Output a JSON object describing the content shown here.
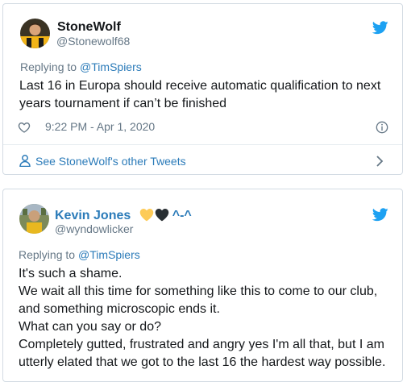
{
  "tweets": [
    {
      "display_name": "StoneWolf",
      "handle": "@Stonewolf68",
      "reply_prefix": "Replying to",
      "reply_to": "@TimSpiers",
      "body_lines": [
        "Last 16 in Europa should receive automatic qualification to next",
        "years tournament if can’t be finished"
      ],
      "timestamp": "9:22 PM - Apr 1, 2020",
      "see_other_tweets": "See StoneWolf's other Tweets",
      "icons": [
        "avatar",
        "twitter-logo-icon",
        "heart-icon",
        "info-icon",
        "person-icon",
        "chevron-right-icon"
      ]
    },
    {
      "display_name": "Kevin Jones",
      "name_suffix": "^-^",
      "handle": "@wyndowlicker",
      "reply_prefix": "Replying to",
      "reply_to": "@TimSpiers",
      "body_lines": [
        "It's such a shame.",
        "We wait all this time for something like this to come to our club,",
        "and something microscopic ends it.",
        "What can you say or do?",
        "Completely gutted, frustrated and angry yes I'm all that, but I am",
        "utterly elated that we got to the last 16 the hardest way possible."
      ],
      "icons": [
        "avatar",
        "yellow-heart-icon",
        "black-heart-icon",
        "twitter-logo-icon"
      ]
    }
  ],
  "colors": {
    "link_blue": "#2b7bb9",
    "secondary_gray": "#657786",
    "twitter_blue": "#1da1f2",
    "border": "#d3dbe3",
    "text": "#14171a"
  }
}
